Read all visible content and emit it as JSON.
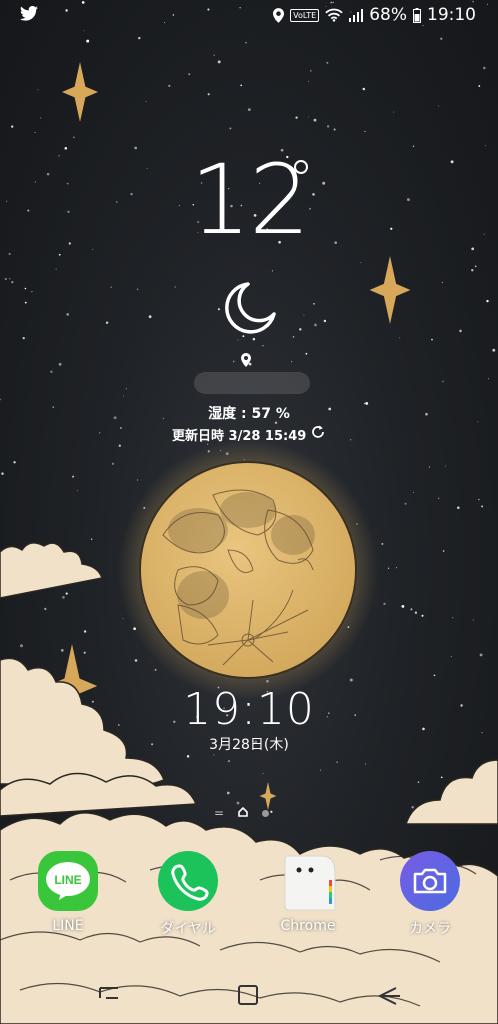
{
  "status_bar": {
    "left_icon": "twitter-icon",
    "battery": "68%",
    "time": "19:10",
    "volte": "VoLTE",
    "icons": [
      "location-icon",
      "volte-icon",
      "wifi-icon",
      "signal-icon",
      "battery-icon"
    ]
  },
  "weather": {
    "temperature": "12",
    "condition_icon": "crescent-moon-icon",
    "humidity": "湿度 : 57 %",
    "updated": "更新日時 3/28 15:49"
  },
  "clock": {
    "time": "19:10",
    "date": "3月28日(木)"
  },
  "page_indicator": {
    "items": [
      "menu-lines",
      "home",
      "dot"
    ],
    "menu_glyph": "="
  },
  "dock": [
    {
      "label": "LINE",
      "icon": "line-icon",
      "color": "#3ac63a"
    },
    {
      "label": "ダイヤル",
      "icon": "phone-icon",
      "color": "#1cc25a"
    },
    {
      "label": "Chrome",
      "icon": "chrome-ghost-icon",
      "color": "#f4f4f2"
    },
    {
      "label": "カメラ",
      "icon": "camera-icon",
      "color": "#5a5ce0"
    }
  ],
  "line_icon_text": "LINE",
  "colors": {
    "sky": "#1f2226",
    "moon": "#d9b067",
    "star": "#d7a75a",
    "cloud": "#f1e1c9"
  }
}
